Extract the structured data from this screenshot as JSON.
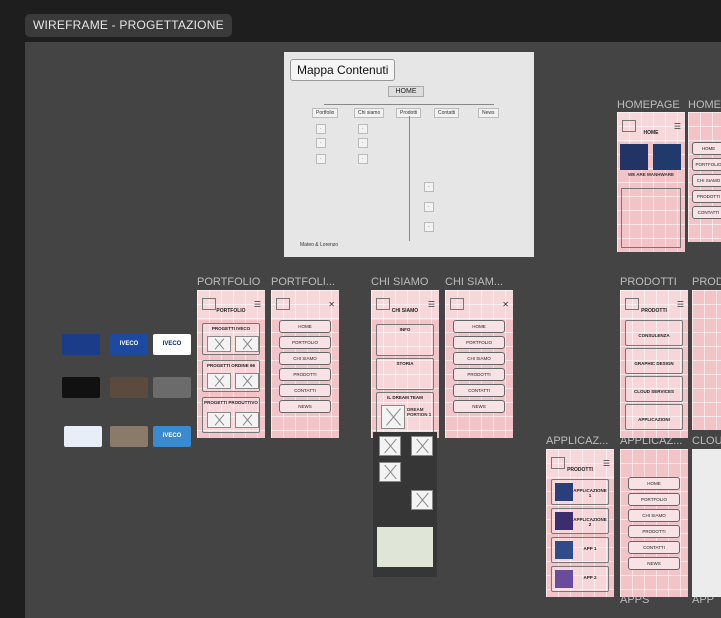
{
  "header": {
    "title": "WIREFRAME - PROGETTAZIONE"
  },
  "map": {
    "title": "Mappa Contenuti",
    "home": "HOME",
    "branches": [
      "Portfolio",
      "Chi siamo",
      "Prodotti",
      "Contatti",
      "News"
    ],
    "signature": "Mateo & Lorenzo"
  },
  "frames": {
    "homepage": "HOMEPAGE",
    "home_trunc": "HOME",
    "portfolio": "PORTFOLIO",
    "portfolio_menu": "PORTFOLI...",
    "chi_siamo": "CHI SIAMO",
    "chi_siamo_menu": "CHI SIAM...",
    "prodotti": "PRODOTTI",
    "prodotti_trunc": "PROD",
    "applicaz_1": "APPLICAZ...",
    "applicaz_2": "APPLICAZ...",
    "clou": "CLOU",
    "apps": "APPS",
    "app": "APP"
  },
  "phones": {
    "portfolio": {
      "title": "PORTFOLIO",
      "cards": [
        "PROGETTI IVECO",
        "PROGETTI ORDINE 66",
        "PROGETTI PRODUTTIVO"
      ]
    },
    "menu_items": [
      "HOME",
      "PORTFOLIO",
      "CHI SIAMO",
      "PRODOTTI",
      "CONTATTI",
      "NEWS"
    ],
    "chi_siamo": {
      "title": "CHI SIAMO",
      "sections": [
        "INFO",
        "STORIA",
        "IL DREAM TEAM"
      ],
      "member": "DREAM PORTION 1"
    },
    "homepage": {
      "title": "HOME",
      "tagline": "WE ARE MANHWARE"
    },
    "prodotti": {
      "title": "PRODOTTI",
      "items": [
        "CONSULENZA",
        "GRAPHIC DESIGN",
        "CLOUD SERVICES",
        "APPLICAZIONI"
      ]
    },
    "applicazioni": {
      "title": "PRODOTTI",
      "items": [
        "APPLICAZIONE 1",
        "APPLICAZIONE 2",
        "APP 1",
        "APP 2"
      ]
    }
  },
  "thumbs": [
    "IVECO",
    "IVECO",
    "IVECO"
  ],
  "colors": {
    "phone": "#f2c4c8",
    "canvas": "#444444",
    "bg": "#1e1e1e"
  }
}
